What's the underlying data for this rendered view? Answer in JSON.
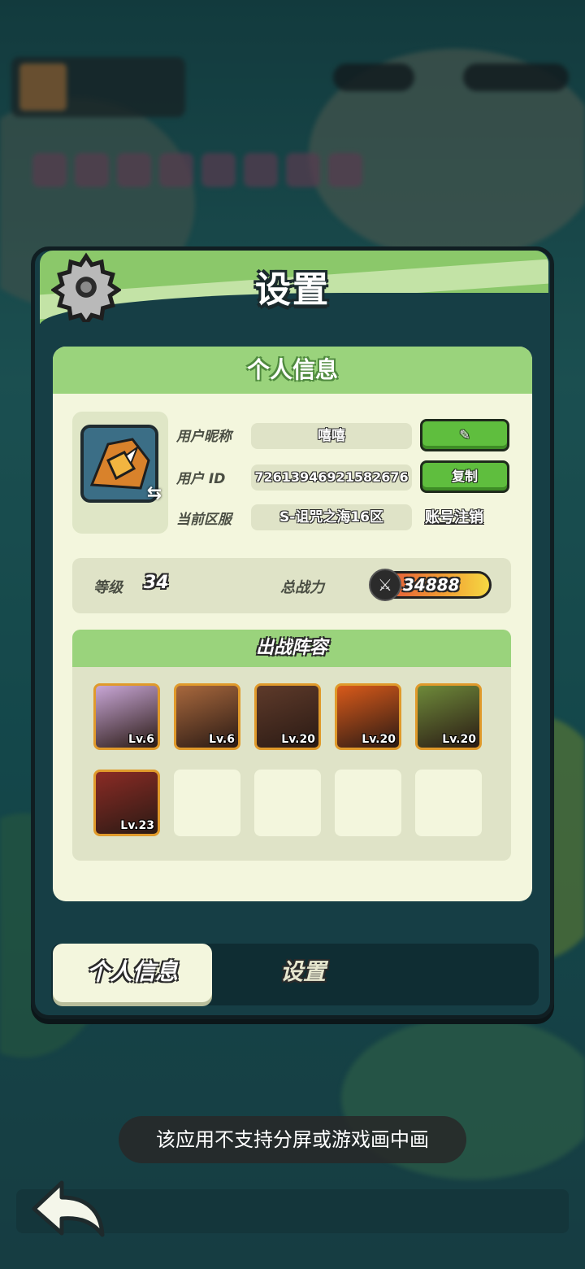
{
  "dialog": {
    "title": "设置"
  },
  "personal_info": {
    "section_title": "个人信息",
    "nickname_label": "用户昵称",
    "nickname_value": "嘻嘻",
    "id_label": "用户 ID",
    "id_value": "7261394692158267​6",
    "server_label": "当前区服",
    "server_value": "S-诅咒之海16区",
    "copy_label": "复制",
    "logout_label": "账号注销"
  },
  "stats": {
    "level_label": "等级",
    "level_value": "34",
    "power_label": "总战力",
    "power_value": "34888"
  },
  "lineup": {
    "title": "出战阵容",
    "heroes": [
      {
        "level": "Lv.6",
        "color": "#c8a6d6"
      },
      {
        "level": "Lv.6",
        "color": "#a8683d"
      },
      {
        "level": "Lv.20",
        "color": "#5e3a2a"
      },
      {
        "level": "Lv.20",
        "color": "#d95a1a"
      },
      {
        "level": "Lv.20",
        "color": "#6e8a3a"
      },
      {
        "level": "Lv.23",
        "color": "#8b2b25"
      }
    ]
  },
  "tabs": {
    "active": "个人信息",
    "inactive": "设置"
  },
  "toast": {
    "message": "该应用不支持分屏或游戏画中画"
  },
  "colors": {
    "header_green": "#8bc86a",
    "panel_bg": "#f3f6dd",
    "button_green": "#5fbe3e",
    "slot_border": "#e09a2b"
  }
}
